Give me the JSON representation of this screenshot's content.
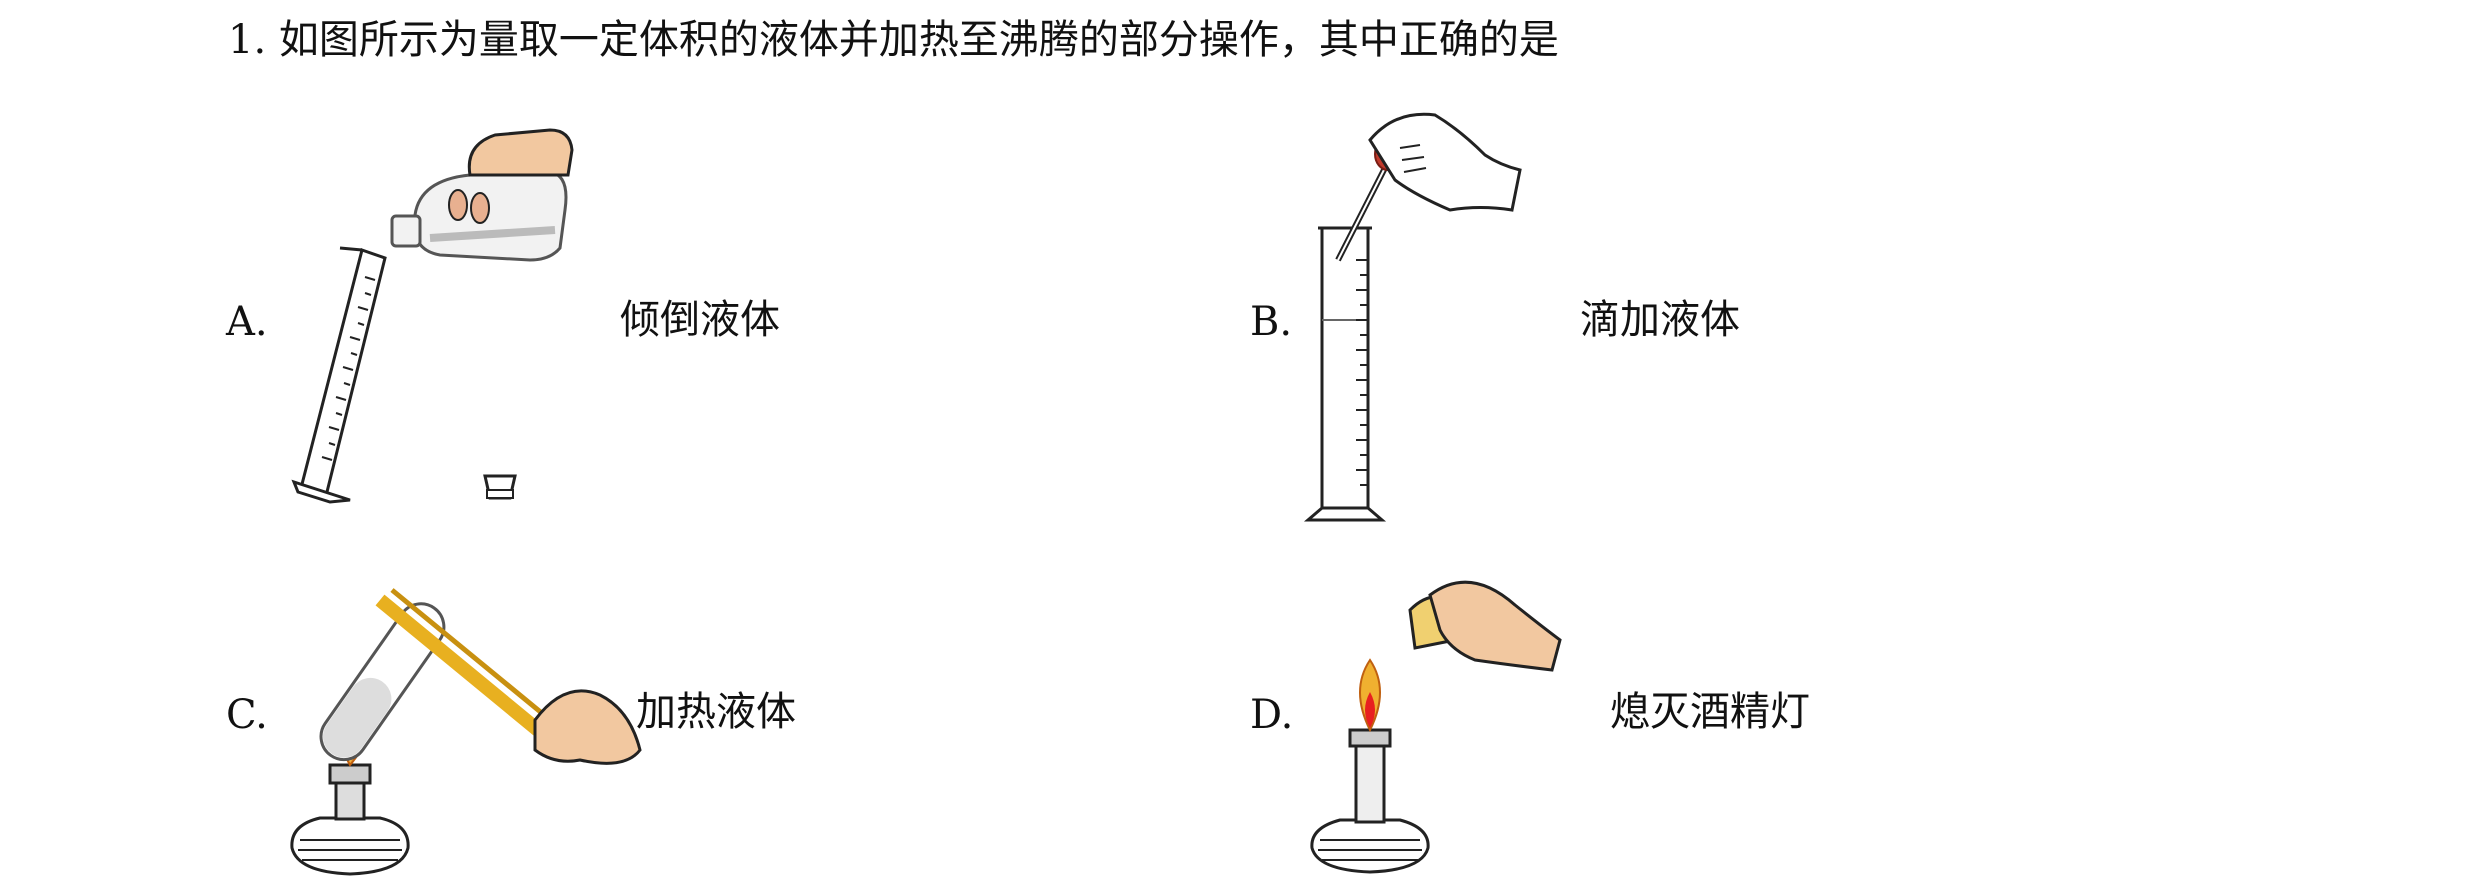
{
  "question": {
    "number": "1.",
    "stem": "如图所示为量取一定体积的液体并加热至沸腾的部分操作，其中正确的是"
  },
  "options": [
    {
      "letter": "A.",
      "text": "倾倒液体",
      "icon": "pouring-liquid-into-graduated-cylinder"
    },
    {
      "letter": "B.",
      "text": "滴加液体",
      "icon": "dropper-over-graduated-cylinder"
    },
    {
      "letter": "C.",
      "text": "加热液体",
      "icon": "heating-test-tube-over-alcohol-lamp"
    },
    {
      "letter": "D.",
      "text": "熄灭酒精灯",
      "icon": "extinguishing-alcohol-lamp-with-cap"
    }
  ]
}
